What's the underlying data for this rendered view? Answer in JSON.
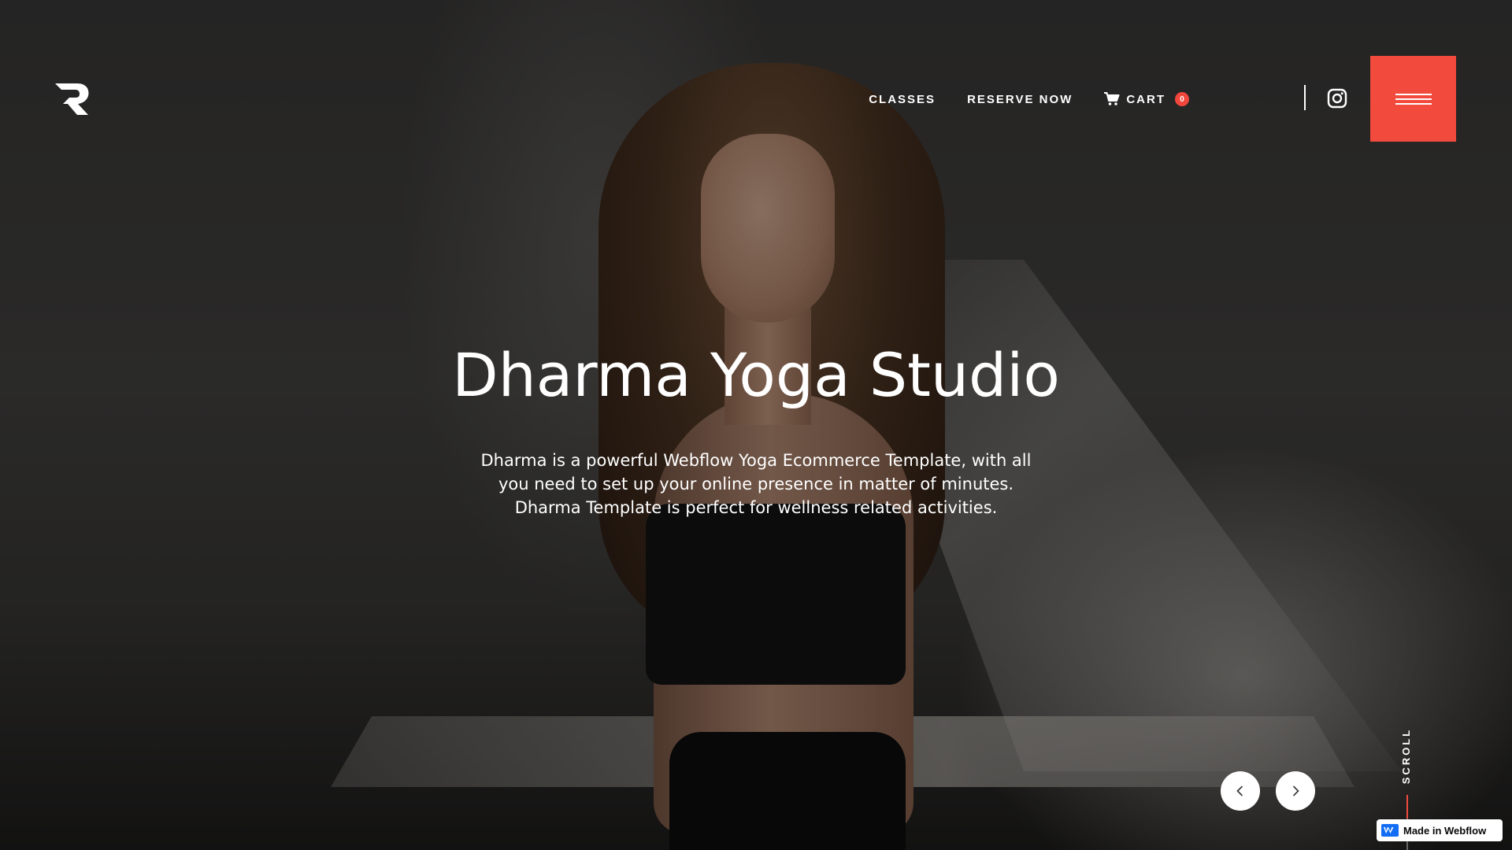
{
  "header": {
    "logo_icon": "r-logo-icon",
    "nav": {
      "classes": "CLASSES",
      "reserve_now": "RESERVE NOW",
      "cart_label": "CART",
      "cart_count": "0"
    },
    "cart_icon": "cart-icon",
    "instagram_icon": "instagram-icon",
    "menu_icon": "hamburger-icon"
  },
  "hero": {
    "title": "Dharma Yoga Studio",
    "description": "Dharma is a powerful Webflow Yoga Ecommerce Template, with all you need to set up your online presence in matter of minutes. Dharma Template is perfect for wellness related activities."
  },
  "slider": {
    "prev_icon": "chevron-left-icon",
    "next_icon": "chevron-right-icon"
  },
  "scroll": {
    "label": "SCROLL"
  },
  "badge": {
    "label": "Made in Webflow",
    "icon": "webflow-icon"
  },
  "colors": {
    "accent": "#f24a3d",
    "text": "#ffffff",
    "overlay": "rgba(0,0,0,0.38)"
  }
}
